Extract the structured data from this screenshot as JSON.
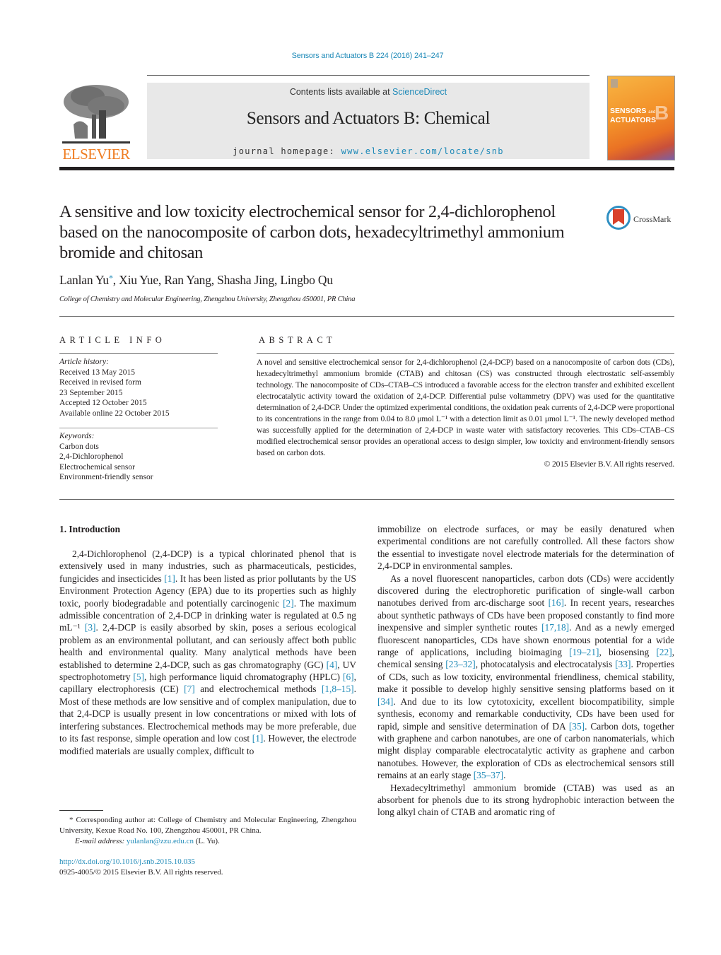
{
  "header": {
    "citation": "Sensors and Actuators B 224 (2016) 241–247",
    "contents_prefix": "Contents lists available at ",
    "contents_link": "ScienceDirect",
    "journal_title": "Sensors and Actuators B: Chemical",
    "homepage_prefix": "journal homepage: ",
    "homepage_link": "www.elsevier.com/locate/snb",
    "publisher_logo_text": "ELSEVIER",
    "cover_line1": "SENSORS",
    "cover_and": "and",
    "cover_line2": "ACTUATORS",
    "cover_letter": "B"
  },
  "article": {
    "title": "A sensitive and low toxicity electrochemical sensor for 2,4-dichlorophenol based on the nanocomposite of carbon dots, hexadecyltrimethyl ammonium bromide and chitosan",
    "crossmark_label": "CrossMark",
    "authors_first": "Lanlan Yu",
    "authors_star": "*",
    "authors_rest": ", Xiu Yue, Ran Yang, Shasha Jing, Lingbo Qu",
    "affiliation": "College of Chemistry and Molecular Engineering, Zhengzhou University, Zhengzhou 450001, PR China"
  },
  "article_info": {
    "heading": "ARTICLE INFO",
    "history_label": "Article history:",
    "history": [
      "Received 13 May 2015",
      "Received in revised form",
      "23 September 2015",
      "Accepted 12 October 2015",
      "Available online 22 October 2015"
    ],
    "keywords_label": "Keywords:",
    "keywords": [
      "Carbon dots",
      "2,4-Dichlorophenol",
      "Electrochemical sensor",
      "Environment-friendly sensor"
    ]
  },
  "abstract": {
    "heading": "ABSTRACT",
    "text": "A novel and sensitive electrochemical sensor for 2,4-dichlorophenol (2,4-DCP) based on a nanocomposite of carbon dots (CDs), hexadecyltrimethyl ammonium bromide (CTAB) and chitosan (CS) was constructed through electrostatic self-assembly technology. The nanocomposite of CDs–CTAB–CS introduced a favorable access for the electron transfer and exhibited excellent electrocatalytic activity toward the oxidation of 2,4-DCP. Differential pulse voltammetry (DPV) was used for the quantitative determination of 2,4-DCP. Under the optimized experimental conditions, the oxidation peak currents of 2,4-DCP were proportional to its concentrations in the range from 0.04 to 8.0 μmol L⁻¹ with a detection limit as 0.01 μmol L⁻¹. The newly developed method was successfully applied for the determination of 2,4-DCP in waste water with satisfactory recoveries. This CDs–CTAB–CS modified electrochemical sensor provides an operational access to design simpler, low toxicity and environment-friendly sensors based on carbon dots.",
    "copyright": "© 2015 Elsevier B.V. All rights reserved."
  },
  "introduction": {
    "heading": "1.  Introduction",
    "left_p1": [
      {
        "t": "2,4-Dichlorophenol (2,4-DCP) is a typical chlorinated phenol that is extensively used in many industries, such as pharmaceuticals, pesticides, fungicides and insecticides "
      },
      {
        "ref": "[1]"
      },
      {
        "t": ". It has been listed as prior pollutants by the US Environment Protection Agency (EPA) due to its properties such as highly toxic, poorly biodegradable and potentially carcinogenic "
      },
      {
        "ref": "[2]"
      },
      {
        "t": ". The maximum admissible concentration of 2,4-DCP in drinking water is regulated at 0.5 ng mL⁻¹ "
      },
      {
        "ref": "[3]"
      },
      {
        "t": ". 2,4-DCP is easily absorbed by skin, poses a serious ecological problem as an environmental pollutant, and can seriously affect both public health and environmental quality. Many analytical methods have been established to determine 2,4-DCP, such as gas chromatography (GC) "
      },
      {
        "ref": "[4]"
      },
      {
        "t": ", UV spectrophotometry "
      },
      {
        "ref": "[5]"
      },
      {
        "t": ", high performance liquid chromatography (HPLC) "
      },
      {
        "ref": "[6]"
      },
      {
        "t": ", capillary electrophoresis (CE) "
      },
      {
        "ref": "[7]"
      },
      {
        "t": " and electrochemical methods "
      },
      {
        "ref": "[1,8–15]"
      },
      {
        "t": ". Most of these methods are low sensitive and of complex manipulation, due to that 2,4-DCP is usually present in low concentrations or mixed with lots of interfering substances. Electrochemical methods may be more preferable, due to its fast response, simple operation and low cost "
      },
      {
        "ref": "[1]"
      },
      {
        "t": ". However, the electrode modified materials are usually complex, difficult to"
      }
    ],
    "right_p1": "immobilize on electrode surfaces, or may be easily denatured when experimental conditions are not carefully controlled. All these factors show the essential to investigate novel electrode materials for the determination of 2,4-DCP in environmental samples.",
    "right_p2": [
      {
        "t": "As a novel fluorescent nanoparticles, carbon dots (CDs) were accidently discovered during the electrophoretic purification of single-wall carbon nanotubes derived from arc-discharge soot "
      },
      {
        "ref": "[16]"
      },
      {
        "t": ". In recent years, researches about synthetic pathways of CDs have been proposed constantly to find more inexpensive and simpler synthetic routes "
      },
      {
        "ref": "[17,18]"
      },
      {
        "t": ". And as a newly emerged fluorescent nanoparticles, CDs have shown enormous potential for a wide range of applications, including bioimaging "
      },
      {
        "ref": "[19–21]"
      },
      {
        "t": ", biosensing "
      },
      {
        "ref": "[22]"
      },
      {
        "t": ", chemical sensing "
      },
      {
        "ref": "[23–32]"
      },
      {
        "t": ", photocatalysis and electrocatalysis "
      },
      {
        "ref": "[33]"
      },
      {
        "t": ". Properties of CDs, such as low toxicity, environmental friendliness, chemical stability, make it possible to develop highly sensitive sensing platforms based on it "
      },
      {
        "ref": "[34]"
      },
      {
        "t": ". And due to its low cytotoxicity, excellent biocompatibility, simple synthesis, economy and remarkable conductivity, CDs have been used for rapid, simple and sensitive determination of DA "
      },
      {
        "ref": "[35]"
      },
      {
        "t": ". Carbon dots, together with graphene and carbon nanotubes, are one of carbon nanomaterials, which might display comparable electrocatalytic activity as graphene and carbon nanotubes. However, the exploration of CDs as electrochemical sensors still remains at an early stage "
      },
      {
        "ref": "[35–37]"
      },
      {
        "t": "."
      }
    ],
    "right_p3": "Hexadecyltrimethyl ammonium bromide (CTAB) was used as an absorbent for phenols due to its strong hydrophobic interaction between the long alkyl chain of CTAB and aromatic ring of"
  },
  "footnote": {
    "corresponding": "* Corresponding author at: College of Chemistry and Molecular Engineering, Zhengzhou University, Kexue Road No. 100, Zhengzhou 450001, PR China.",
    "email_label": "E-mail address: ",
    "email": "yulanlan@zzu.edu.cn",
    "email_suffix": " (L. Yu).",
    "doi": "http://dx.doi.org/10.1016/j.snb.2015.10.035",
    "issn": "0925-4005/© 2015 Elsevier B.V. All rights reserved."
  },
  "colors": {
    "link": "#1f8ab8",
    "elsevier_orange": "#ef7d22",
    "text": "#231f20"
  }
}
